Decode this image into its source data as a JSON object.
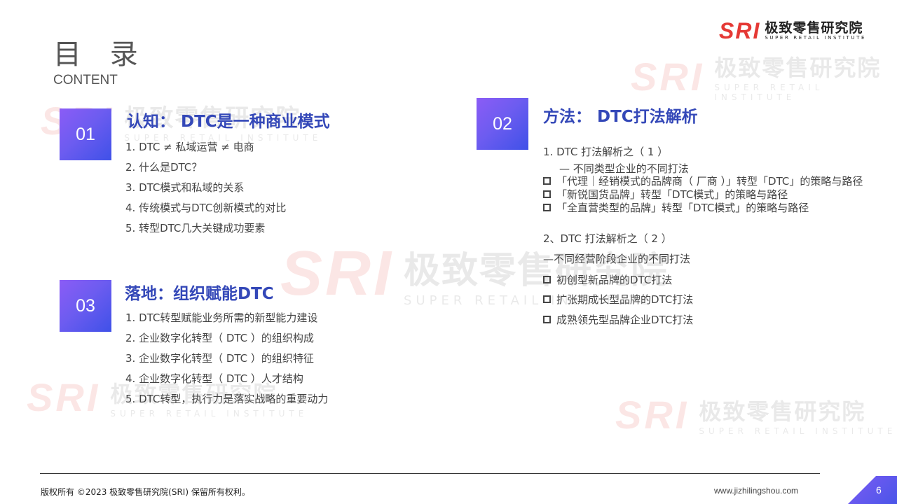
{
  "logo": {
    "mark": "SRI",
    "cn": "极致零售研究院",
    "en": "SUPER RETAIL INSTITUTE"
  },
  "watermark": {
    "mark": "SRI",
    "cn": "极致零售研究院",
    "en": "SUPER RETAIL INSTITUTE"
  },
  "header": {
    "title": "目 录",
    "subtitle": "CONTENT"
  },
  "section1": {
    "number": "01",
    "title": "认知： DTC是一种商业模式",
    "items": [
      "1.  DTC ≠ 私域运营 ≠ 电商",
      "2.  什么是DTC？",
      "3.  DTC模式和私域的关系",
      "4.  传统模式与DTC创新模式的对比",
      "5.  转型DTC几大关键成功要素"
    ]
  },
  "section2": {
    "number": "02",
    "title": "方法： DTC打法解析",
    "part1_heading": "1.  DTC 打法解析之（ 1 ）",
    "part1_sub": "— 不同类型企业的不同打法",
    "part1_items": [
      "「代理｜经销模式的品牌商（ 厂商 ）」转型「DTC」的策略与路径",
      "「新锐国货品牌」转型「DTC模式」的策略与路径",
      "「全直营类型的品牌」转型「DTC模式」的策略与路径"
    ],
    "part2_heading": "2、DTC 打法解析之（ 2 ）",
    "part2_sub": "—不同经营阶段企业的不同打法",
    "part2_items": [
      "初创型新品牌的DTC打法",
      "扩张期成长型品牌的DTC打法",
      "成熟领先型品牌企业DTC打法"
    ]
  },
  "section3": {
    "number": "03",
    "title": "落地：组织赋能DTC",
    "items": [
      "1.  DTC转型赋能业务所需的新型能力建设",
      "2.  企业数字化转型（ DTC ）的组织构成",
      "3.  企业数字化转型（ DTC ）的组织特征",
      "4.  企业数字化转型（ DTC ）人才结构",
      "5.  DTC转型，执行力是落实战略的重要动力"
    ]
  },
  "footer": {
    "copyright": "版权所有 ©2023  极致零售研究院(SRI)  保留所有权利。",
    "website": "www.jizhilingshou.com",
    "page": "6"
  },
  "colors": {
    "accent": "#3448b8",
    "brand_red": "#e53935",
    "box_gradient_start": "#8b5cf6",
    "box_gradient_end": "#3f51e8"
  }
}
